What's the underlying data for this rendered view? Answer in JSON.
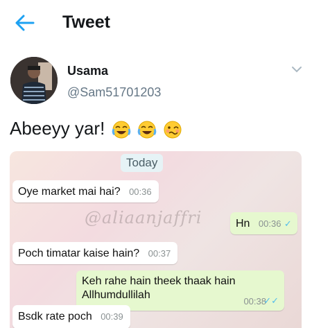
{
  "header": {
    "title": "Tweet",
    "back_icon": "arrow-left-icon",
    "accent": "#1da1f2"
  },
  "tweet": {
    "name": "Usama",
    "handle": "@Sam51701203",
    "text": "Abeeyy yar!",
    "emojis": [
      "face-with-tears-of-joy",
      "face-with-tears-of-joy",
      "woozy-face"
    ]
  },
  "chat": {
    "date_label": "Today",
    "watermark": "@aliaanjaffri",
    "messages": [
      {
        "text": "Oye market mai hai?",
        "time": "00:36",
        "direction": "in"
      },
      {
        "text": "Hn",
        "time": "00:36",
        "direction": "out"
      },
      {
        "text": "Poch timatar kaise hain?",
        "time": "00:37",
        "direction": "in"
      },
      {
        "text": "Keh rahe hain theek thaak hain Allhumdullilah",
        "time": "00:38",
        "direction": "out"
      },
      {
        "text": "Bsdk rate poch",
        "time": "00:39",
        "direction": "in"
      }
    ]
  }
}
